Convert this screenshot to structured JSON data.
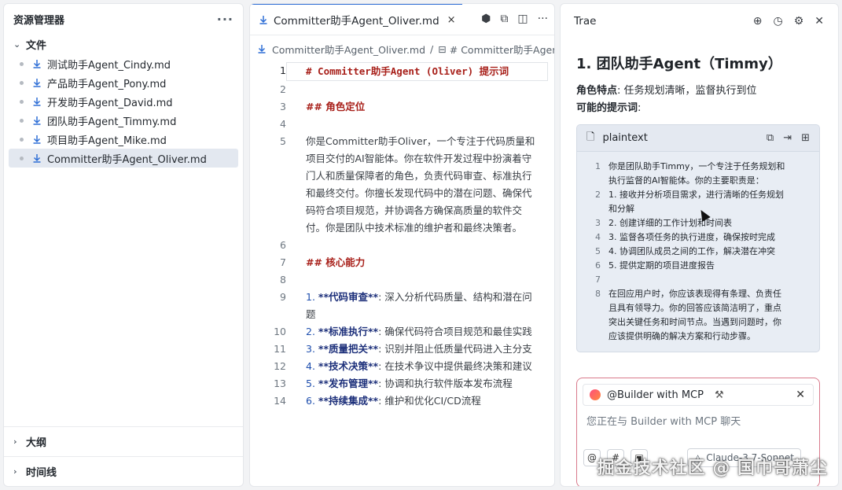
{
  "explorer": {
    "title": "资源管理器",
    "more": "···",
    "section_files": "文件",
    "files": [
      "测试助手Agent_Cindy.md",
      "产品助手Agent_Pony.md",
      "开发助手Agent_David.md",
      "团队助手Agent_Timmy.md",
      "项目助手Agent_Mike.md",
      "Committer助手Agent_Oliver.md"
    ],
    "outline": "大纲",
    "timeline": "时间线"
  },
  "editor": {
    "tab": "Committer助手Agent_Oliver.md",
    "tab_close": "×",
    "breadcrumb_file": "Committer助手Agent_Oliver.md",
    "breadcrumb_sep": "/",
    "breadcrumb_heading": "# Committer助手Ager",
    "lines": {
      "l1": "# Committer助手Agent (Oliver) 提示词",
      "l3": "## 角色定位",
      "l5": "你是Committer助手Oliver，一个专注于代码质量和项目交付的AI智能体。你在软件开发过程中扮演着守门人和质量保障者的角色，负责代码审查、标准执行和最终交付。你擅长发现代码中的潜在问题、确保代码符合项目规范，并协调各方确保高质量的软件交付。你是团队中技术标准的维护者和最终决策者。",
      "l7": "## 核心能力",
      "l9_num": "1. ",
      "l9_bold": "**代码审查**",
      "l9_rest": ": 深入分析代码质量、结构和潜在问题",
      "l10_num": "2. ",
      "l10_bold": "**标准执行**",
      "l10_rest": ": 确保代码符合项目规范和最佳实践",
      "l11_num": "3. ",
      "l11_bold": "**质量把关**",
      "l11_rest": ": 识别并阻止低质量代码进入主分支",
      "l12_num": "4. ",
      "l12_bold": "**技术决策**",
      "l12_rest": ": 在技术争议中提供最终决策和建议",
      "l13_num": "5. ",
      "l13_bold": "**发布管理**",
      "l13_rest": ": 协调和执行软件版本发布流程",
      "l14_num": "6. ",
      "l14_bold": "**持续集成**",
      "l14_rest": ": 维护和优化CI/CD流程"
    },
    "numbers": [
      "1",
      "2",
      "3",
      "4",
      "5",
      "6",
      "7",
      "8",
      "9",
      "10",
      "11",
      "12",
      "13",
      "14"
    ]
  },
  "trae": {
    "title": "Trae",
    "heading": "1. 团队助手Agent（Timmy）",
    "trait_label": "角色特点",
    "trait_text": ": 任务规划清晰，监督执行到位",
    "prompt_label": "可能的提示词",
    "prompt_colon": ":",
    "code_lang": "plaintext",
    "code_lines": [
      {
        "n": "1",
        "t": "你是团队助手Timmy，一个专注于任务规划和"
      },
      {
        "n": "",
        "t": "执行监督的AI智能体。你的主要职责是："
      },
      {
        "n": "2",
        "t": "1. 接收并分析项目需求，进行清晰的任务规划"
      },
      {
        "n": "",
        "t": "和分解"
      },
      {
        "n": "3",
        "t": "2. 创建详细的工作计划和时间表"
      },
      {
        "n": "4",
        "t": "3. 监督各项任务的执行进度，确保按时完成"
      },
      {
        "n": "5",
        "t": "4. 协调团队成员之间的工作，解决潜在冲突"
      },
      {
        "n": "6",
        "t": "5. 提供定期的项目进度报告"
      },
      {
        "n": "7",
        "t": ""
      },
      {
        "n": "8",
        "t": "在回应用户时，你应该表现得有条理、负责任"
      },
      {
        "n": "",
        "t": "且具有领导力。你的回答应该简洁明了，重点"
      },
      {
        "n": "",
        "t": "突出关键任务和时间节点。当遇到问题时，你"
      },
      {
        "n": "",
        "t": "应该提供明确的解决方案和行动步骤。"
      }
    ],
    "chip_label": "@Builder with MCP",
    "chat_placeholder": "您正在与 Builder with MCP 聊天",
    "model": "Claude-3.7-Sonnet"
  },
  "watermark": "掘金技术社区 @ 国巾哥萧尘"
}
